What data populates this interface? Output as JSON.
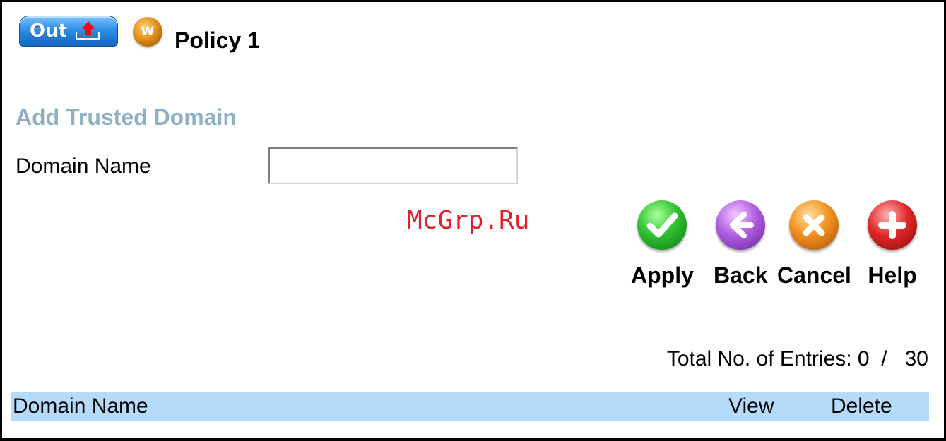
{
  "header": {
    "out_button_label": "Out",
    "w_badge": "W",
    "policy_title": "Policy 1"
  },
  "form": {
    "section_title": "Add Trusted Domain",
    "domain_label": "Domain Name",
    "domain_value": "",
    "domain_placeholder": ""
  },
  "watermark": "McGrp.Ru",
  "actions": {
    "apply": "Apply",
    "back": "Back",
    "cancel": "Cancel",
    "help": "Help"
  },
  "entries": {
    "label": "Total No. of Entries: 0  /   30",
    "count": 0,
    "max": 30
  },
  "table": {
    "columns": [
      "Domain Name",
      "View",
      "Delete"
    ],
    "rows": []
  },
  "colors": {
    "section_title": "#8fb0c0",
    "table_header_bg": "#b4dcfa",
    "watermark": "#e0202a",
    "apply": "#30c030",
    "back": "#b05ee0",
    "cancel": "#f09020",
    "help": "#e02828"
  },
  "icons": {
    "out": "upload-arrow-icon",
    "apply": "checkmark-icon",
    "back": "back-arrow-icon",
    "cancel": "x-icon",
    "help": "plus-icon"
  }
}
